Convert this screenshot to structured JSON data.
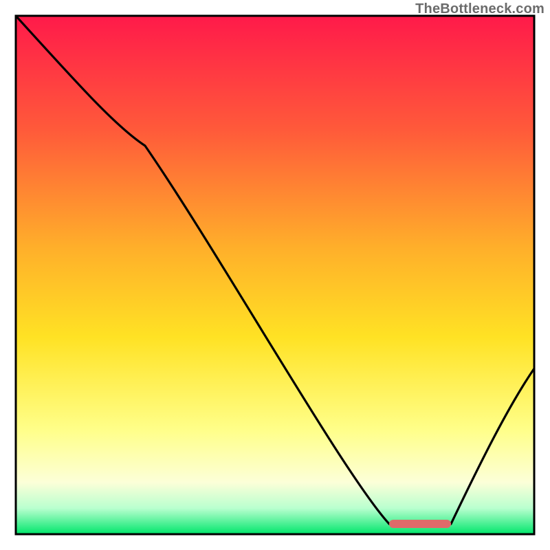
{
  "watermark": "TheBottleneck.com",
  "chart_data": {
    "type": "line",
    "title": "",
    "xlabel": "",
    "ylabel": "",
    "xlim": [
      0,
      100
    ],
    "ylim": [
      0,
      100
    ],
    "series": [
      {
        "name": "bottleneck-curve",
        "x": [
          0,
          25,
          72,
          80,
          84,
          100
        ],
        "y": [
          100,
          75,
          2,
          2,
          2,
          32
        ]
      }
    ],
    "marker": {
      "name": "optimal-range",
      "x_start": 72,
      "x_end": 84,
      "y": 2
    },
    "colors": {
      "gradient_top": "#ff1a4a",
      "gradient_mid_upper": "#ff8a2b",
      "gradient_mid": "#ffd21f",
      "gradient_mid_lower": "#ffff8a",
      "gradient_lower": "#fdffd9",
      "gradient_bottom": "#00e66b",
      "curve": "#000000",
      "marker": "#e06a6a",
      "border": "#000000"
    }
  }
}
